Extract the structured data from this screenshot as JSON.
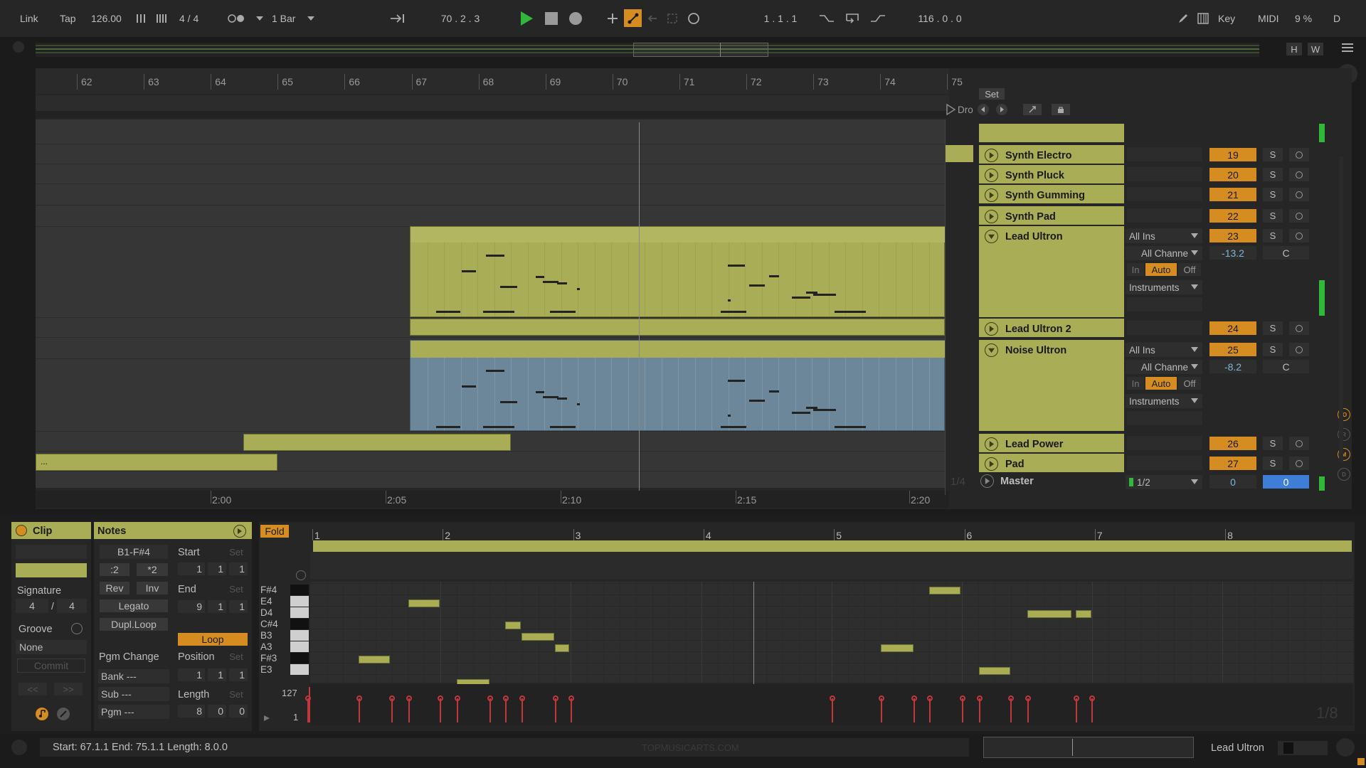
{
  "transport": {
    "link": "Link",
    "tap": "Tap",
    "tempo": "126.00",
    "signature": "4 / 4",
    "quantize": "1 Bar",
    "position": "70 .  2 .  3",
    "loop_start": "1 .  1 .  1",
    "loop_length": "116 .  0 .  0",
    "key": "Key",
    "midi": "MIDI",
    "cpu": "9 %",
    "d": "D"
  },
  "overview": {
    "h_label": "H",
    "w_label": "W"
  },
  "arrangement": {
    "bars": [
      "62",
      "63",
      "64",
      "65",
      "66",
      "67",
      "68",
      "69",
      "70",
      "71",
      "72",
      "73",
      "74",
      "75"
    ],
    "times": [
      "2:00",
      "2:05",
      "2:10",
      "2:15",
      "2:20"
    ],
    "set_label": "Set",
    "locator_label": "Dro",
    "bottom_clip_label": "...",
    "fraction": "1/4"
  },
  "tracks": [
    {
      "name": "Synth Electro",
      "number": "19",
      "solo": "S"
    },
    {
      "name": "Synth Pluck",
      "number": "20",
      "solo": "S"
    },
    {
      "name": "Synth Gumming",
      "number": "21",
      "solo": "S"
    },
    {
      "name": "Synth Pad",
      "number": "22",
      "solo": "S"
    },
    {
      "name": "Lead Ultron",
      "number": "23",
      "solo": "S",
      "input": "All Ins",
      "channel": "All Channe",
      "volume": "-13.2",
      "pan": "C",
      "mon_in": "In",
      "mon_auto": "Auto",
      "mon_off": "Off",
      "output": "Instruments"
    },
    {
      "name": "Lead Ultron 2",
      "number": "24",
      "solo": "S"
    },
    {
      "name": "Noise Ultron",
      "number": "25",
      "solo": "S",
      "input": "All Ins",
      "channel": "All Channe",
      "volume": "-8.2",
      "pan": "C",
      "mon_in": "In",
      "mon_auto": "Auto",
      "mon_off": "Off",
      "output": "Instruments"
    },
    {
      "name": "Lead Power",
      "number": "26",
      "solo": "S"
    },
    {
      "name": "Pad",
      "number": "27",
      "solo": "S"
    }
  ],
  "master": {
    "name": "Master",
    "routing": "1/2",
    "value1": "0",
    "value2": "0"
  },
  "side_indicators": [
    "IO",
    "R",
    "M",
    "D"
  ],
  "clip_panel": {
    "clip_title": "Clip",
    "signature_label": "Signature",
    "sig_num": "4",
    "sig_slash": "/",
    "sig_den": "4",
    "groove_label": "Groove",
    "groove_value": "None",
    "commit": "Commit",
    "prev": "<<",
    "next": ">>"
  },
  "notes_panel": {
    "title": "Notes",
    "range": "B1-F#4",
    "half": ":2",
    "double": "*2",
    "rev": "Rev",
    "inv": "Inv",
    "legato": "Legato",
    "dupl_loop": "Dupl.Loop",
    "pgm_change": "Pgm Change",
    "bank": "Bank ---",
    "sub": "Sub ---",
    "pgm": "Pgm ---",
    "start_label": "Start",
    "start": [
      "1",
      "1",
      "1"
    ],
    "end_label": "End",
    "end": [
      "9",
      "1",
      "1"
    ],
    "loop": "Loop",
    "position_label": "Position",
    "position": [
      "1",
      "1",
      "1"
    ],
    "length_label": "Length",
    "length": [
      "8",
      "0",
      "0"
    ],
    "set": "Set"
  },
  "midi_editor": {
    "fold": "Fold",
    "bars": [
      "1",
      "2",
      "3",
      "4",
      "5",
      "6",
      "7",
      "8"
    ],
    "pitches": [
      "F#4",
      "E4",
      "D4",
      "C#4",
      "B3",
      "A3",
      "F#3",
      "E3"
    ],
    "vel_max": "127",
    "vel_min": "1",
    "grid": "1/8"
  },
  "status": {
    "text": "Start: 67.1.1  End: 75.1.1  Length: 8.0.0",
    "watermark": "TOPMUSICARTS.COM",
    "track": "Lead Ultron"
  },
  "colors": {
    "clip_yellow": "#a9ad55",
    "clip_blue": "#6b8799",
    "orange": "#d58d22",
    "green_play": "#30b83a",
    "velocity_red": "#c0383b"
  }
}
